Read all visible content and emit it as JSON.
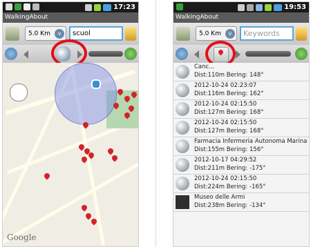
{
  "left": {
    "time": "17:23",
    "title": "WalkingAbout",
    "distance": "5.0 Km",
    "search_value": "scuol",
    "map_label": "Google"
  },
  "right": {
    "time": "19:53",
    "title": "WalkingAbout",
    "distance": "5.0 Km",
    "search_placeholder": "Keywords",
    "list": [
      {
        "title": "Canc...",
        "dist": "Dist:110m Bering: 148°",
        "icon": "globe-icon"
      },
      {
        "title": "2012-10-24 02:23:07",
        "dist": "Dist:116m Bering: 162°",
        "icon": "globe-icon"
      },
      {
        "title": "2012-10-24 02:15:50",
        "dist": "Dist:127m Bering: 168°",
        "icon": "globe-icon"
      },
      {
        "title": "2012-10-24 02:15:50",
        "dist": "Dist:127m Bering: 168°",
        "icon": "globe-icon"
      },
      {
        "title": "Farmacia Infermeria Autonoma Marina ...",
        "dist": "Dist:155m Bering: 156°",
        "icon": "globe-icon"
      },
      {
        "title": "2012-10-17 04:29:52",
        "dist": "Dist:211m Bering: -175°",
        "icon": "globe-icon"
      },
      {
        "title": "2012-10-24 02:15:50",
        "dist": "Dist:224m Bering: -165°",
        "icon": "globe-icon"
      },
      {
        "title": "Museo delle Armi",
        "dist": "Dist:238m Bering: -134°",
        "icon": "photo-icon"
      }
    ]
  },
  "colors": {
    "highlight": "#e0101a",
    "pin": "#d2232a",
    "input_border": "#5aa5d8"
  }
}
